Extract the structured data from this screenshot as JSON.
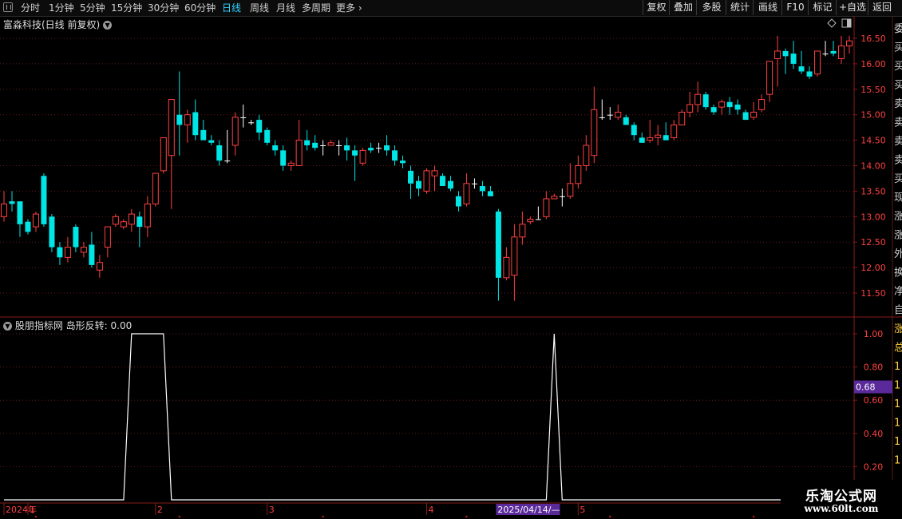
{
  "toolbar": {
    "periods": [
      "分时",
      "1分钟",
      "5分钟",
      "15分钟",
      "30分钟",
      "60分钟",
      "日线",
      "周线",
      "月线",
      "多周期",
      "更多"
    ],
    "active_period": "日线",
    "right_buttons": [
      "复权",
      "叠加",
      "多股",
      "统计",
      "画线",
      "F10",
      "标记",
      "+自选",
      "返回"
    ]
  },
  "chart_title": "富淼科技(日线 前复权)",
  "indicator_title": "股朋指标网 岛形反转: 0.00",
  "price_axis": [
    "16.50",
    "16.00",
    "15.50",
    "15.00",
    "14.50",
    "14.00",
    "13.50",
    "13.00",
    "12.50",
    "12.00",
    "11.50"
  ],
  "indicator_axis": [
    "1.00",
    "0.80",
    "0.60",
    "0.40",
    "0.20"
  ],
  "indicator_cursor_value": "0.68",
  "date_axis": {
    "labels": [
      "2024年",
      "1",
      "2",
      "3",
      "4",
      "5"
    ],
    "cursor_label": "2025/04/14/—"
  },
  "right_edge_glyphs": [
    "委",
    "买",
    "买",
    "买",
    "卖",
    "卖",
    "卖",
    "卖",
    "买",
    "现",
    "涨",
    "涨",
    "外",
    "换",
    "净",
    "自",
    "涨",
    "总",
    "1",
    "1",
    "1",
    "1",
    "1",
    "1"
  ],
  "watermark": {
    "line1": "乐淘公式网",
    "line2": "www.60lt.com"
  },
  "colors": {
    "up": "#ff4040",
    "down": "#00e5e5",
    "doji": "#ffffff",
    "grid": "#6a1a1a",
    "indicator_line": "#ffffff",
    "cursor_bg": "#5a2a9a"
  },
  "chart_data": [
    {
      "type": "candlestick",
      "title": "富淼科技(日线 前复权)",
      "ylim": [
        11.3,
        16.8
      ],
      "ohlc": [
        [
          13.0,
          13.5,
          12.9,
          13.25
        ],
        [
          13.3,
          13.5,
          13.1,
          13.25
        ],
        [
          13.3,
          13.3,
          12.6,
          12.85
        ],
        [
          12.9,
          12.95,
          12.65,
          12.7
        ],
        [
          12.8,
          13.1,
          12.7,
          13.05
        ],
        [
          13.8,
          13.85,
          12.8,
          12.85
        ],
        [
          13.0,
          13.05,
          12.3,
          12.4
        ],
        [
          12.4,
          12.5,
          12.05,
          12.2
        ],
        [
          12.2,
          12.6,
          12.1,
          12.4
        ],
        [
          12.8,
          12.85,
          12.3,
          12.4
        ],
        [
          12.3,
          12.5,
          12.2,
          12.4
        ],
        [
          12.45,
          12.7,
          12.0,
          12.05
        ],
        [
          11.95,
          12.25,
          11.8,
          12.1
        ],
        [
          12.4,
          12.8,
          12.2,
          12.8
        ],
        [
          12.85,
          13.05,
          12.8,
          13.0
        ],
        [
          12.8,
          12.95,
          12.75,
          12.9
        ],
        [
          12.85,
          13.15,
          12.7,
          13.05
        ],
        [
          13.0,
          13.1,
          12.4,
          12.8
        ],
        [
          12.8,
          13.4,
          12.6,
          13.25
        ],
        [
          13.25,
          13.85,
          13.2,
          13.85
        ],
        [
          13.9,
          14.55,
          13.85,
          14.55
        ],
        [
          14.2,
          15.25,
          13.15,
          15.3
        ],
        [
          15.0,
          15.85,
          14.2,
          14.8
        ],
        [
          14.8,
          15.1,
          14.45,
          15.0
        ],
        [
          15.05,
          15.3,
          14.5,
          14.6
        ],
        [
          14.7,
          14.9,
          14.5,
          14.5
        ],
        [
          14.5,
          14.6,
          14.4,
          14.45
        ],
        [
          14.4,
          14.5,
          14.0,
          14.1
        ],
        [
          14.1,
          14.7,
          14.05,
          14.1
        ],
        [
          14.4,
          15.05,
          14.2,
          14.95
        ],
        [
          14.95,
          15.2,
          14.75,
          14.95
        ],
        [
          14.85,
          14.9,
          14.8,
          14.85
        ],
        [
          14.9,
          15.0,
          14.5,
          14.65
        ],
        [
          14.7,
          14.75,
          14.4,
          14.45
        ],
        [
          14.4,
          14.5,
          14.2,
          14.3
        ],
        [
          14.3,
          14.4,
          13.9,
          14.0
        ],
        [
          14.0,
          14.1,
          13.9,
          14.05
        ],
        [
          14.0,
          14.9,
          14.0,
          14.5
        ],
        [
          14.5,
          14.7,
          14.3,
          14.4
        ],
        [
          14.45,
          14.6,
          14.3,
          14.35
        ],
        [
          14.4,
          14.5,
          14.2,
          14.4
        ],
        [
          14.4,
          14.5,
          14.4,
          14.45
        ],
        [
          14.4,
          14.5,
          14.2,
          14.4
        ],
        [
          14.4,
          14.55,
          14.1,
          14.3
        ],
        [
          14.3,
          14.4,
          13.7,
          14.2
        ],
        [
          14.05,
          14.35,
          14.0,
          14.3
        ],
        [
          14.35,
          14.45,
          14.25,
          14.3
        ],
        [
          14.35,
          14.45,
          14.25,
          14.35
        ],
        [
          14.4,
          14.6,
          14.2,
          14.3
        ],
        [
          14.3,
          14.4,
          14.0,
          14.1
        ],
        [
          14.1,
          14.2,
          13.95,
          14.05
        ],
        [
          13.9,
          14.0,
          13.35,
          13.65
        ],
        [
          13.7,
          13.8,
          13.4,
          13.55
        ],
        [
          13.5,
          13.95,
          13.45,
          13.9
        ],
        [
          13.8,
          14.0,
          13.5,
          13.9
        ],
        [
          13.8,
          13.85,
          13.6,
          13.6
        ],
        [
          13.7,
          13.8,
          13.5,
          13.55
        ],
        [
          13.4,
          13.5,
          13.1,
          13.2
        ],
        [
          13.25,
          13.85,
          13.2,
          13.65
        ],
        [
          13.65,
          13.75,
          13.55,
          13.65
        ],
        [
          13.6,
          13.7,
          13.4,
          13.5
        ],
        [
          13.5,
          13.6,
          13.4,
          13.4
        ],
        [
          13.1,
          13.15,
          11.35,
          11.8
        ],
        [
          11.8,
          12.4,
          11.75,
          12.2
        ],
        [
          11.85,
          12.85,
          11.35,
          12.6
        ],
        [
          12.6,
          13.1,
          12.45,
          12.85
        ],
        [
          12.9,
          13.0,
          12.85,
          12.95
        ],
        [
          12.95,
          13.2,
          12.95,
          12.95
        ],
        [
          13.0,
          13.5,
          12.95,
          13.35
        ],
        [
          13.35,
          13.45,
          13.35,
          13.4
        ],
        [
          13.4,
          13.55,
          13.2,
          13.4
        ],
        [
          13.4,
          14.05,
          13.35,
          13.65
        ],
        [
          13.65,
          14.2,
          13.55,
          14.0
        ],
        [
          14.0,
          14.6,
          13.9,
          14.4
        ],
        [
          14.2,
          15.55,
          14.05,
          15.1
        ],
        [
          14.95,
          15.3,
          14.9,
          14.95
        ],
        [
          15.0,
          15.15,
          14.9,
          15.0
        ],
        [
          14.95,
          15.2,
          14.9,
          15.05
        ],
        [
          14.95,
          15.0,
          14.8,
          14.8
        ],
        [
          14.8,
          14.85,
          14.5,
          14.6
        ],
        [
          14.55,
          14.65,
          14.45,
          14.45
        ],
        [
          14.5,
          14.9,
          14.45,
          14.55
        ],
        [
          14.55,
          14.8,
          14.4,
          14.6
        ],
        [
          14.6,
          14.85,
          14.5,
          14.5
        ],
        [
          14.55,
          14.9,
          14.5,
          14.8
        ],
        [
          14.8,
          15.1,
          14.8,
          15.05
        ],
        [
          15.05,
          15.45,
          14.95,
          15.2
        ],
        [
          15.2,
          15.65,
          15.05,
          15.4
        ],
        [
          15.4,
          15.45,
          15.1,
          15.15
        ],
        [
          15.15,
          15.2,
          15.0,
          15.05
        ],
        [
          15.15,
          15.3,
          15.0,
          15.25
        ],
        [
          15.25,
          15.35,
          15.0,
          15.15
        ],
        [
          15.2,
          15.3,
          15.0,
          15.1
        ],
        [
          15.05,
          15.1,
          14.9,
          14.9
        ],
        [
          14.95,
          15.25,
          14.9,
          15.05
        ],
        [
          15.1,
          15.4,
          15.05,
          15.3
        ],
        [
          15.4,
          16.0,
          15.25,
          16.05
        ],
        [
          16.1,
          16.55,
          15.55,
          16.25
        ],
        [
          16.25,
          16.3,
          15.8,
          16.15
        ],
        [
          16.2,
          16.45,
          15.9,
          16.0
        ],
        [
          15.95,
          16.25,
          15.8,
          15.85
        ],
        [
          15.85,
          15.95,
          15.7,
          15.75
        ],
        [
          15.8,
          16.25,
          15.75,
          16.25
        ],
        [
          16.2,
          16.45,
          16.15,
          16.2
        ],
        [
          16.25,
          16.45,
          16.15,
          16.2
        ],
        [
          16.1,
          16.55,
          16.0,
          16.35
        ],
        [
          16.35,
          16.55,
          16.2,
          16.45
        ]
      ]
    },
    {
      "type": "line",
      "title": "股朋指标网 岛形反转",
      "ylim": [
        0,
        1.05
      ],
      "series": [
        {
          "name": "岛形反转",
          "values": []
        }
      ],
      "spikes": [
        {
          "start": 16,
          "end": 18
        },
        {
          "start": 19,
          "end": 20
        },
        {
          "start": 69,
          "end": 69
        }
      ]
    }
  ]
}
